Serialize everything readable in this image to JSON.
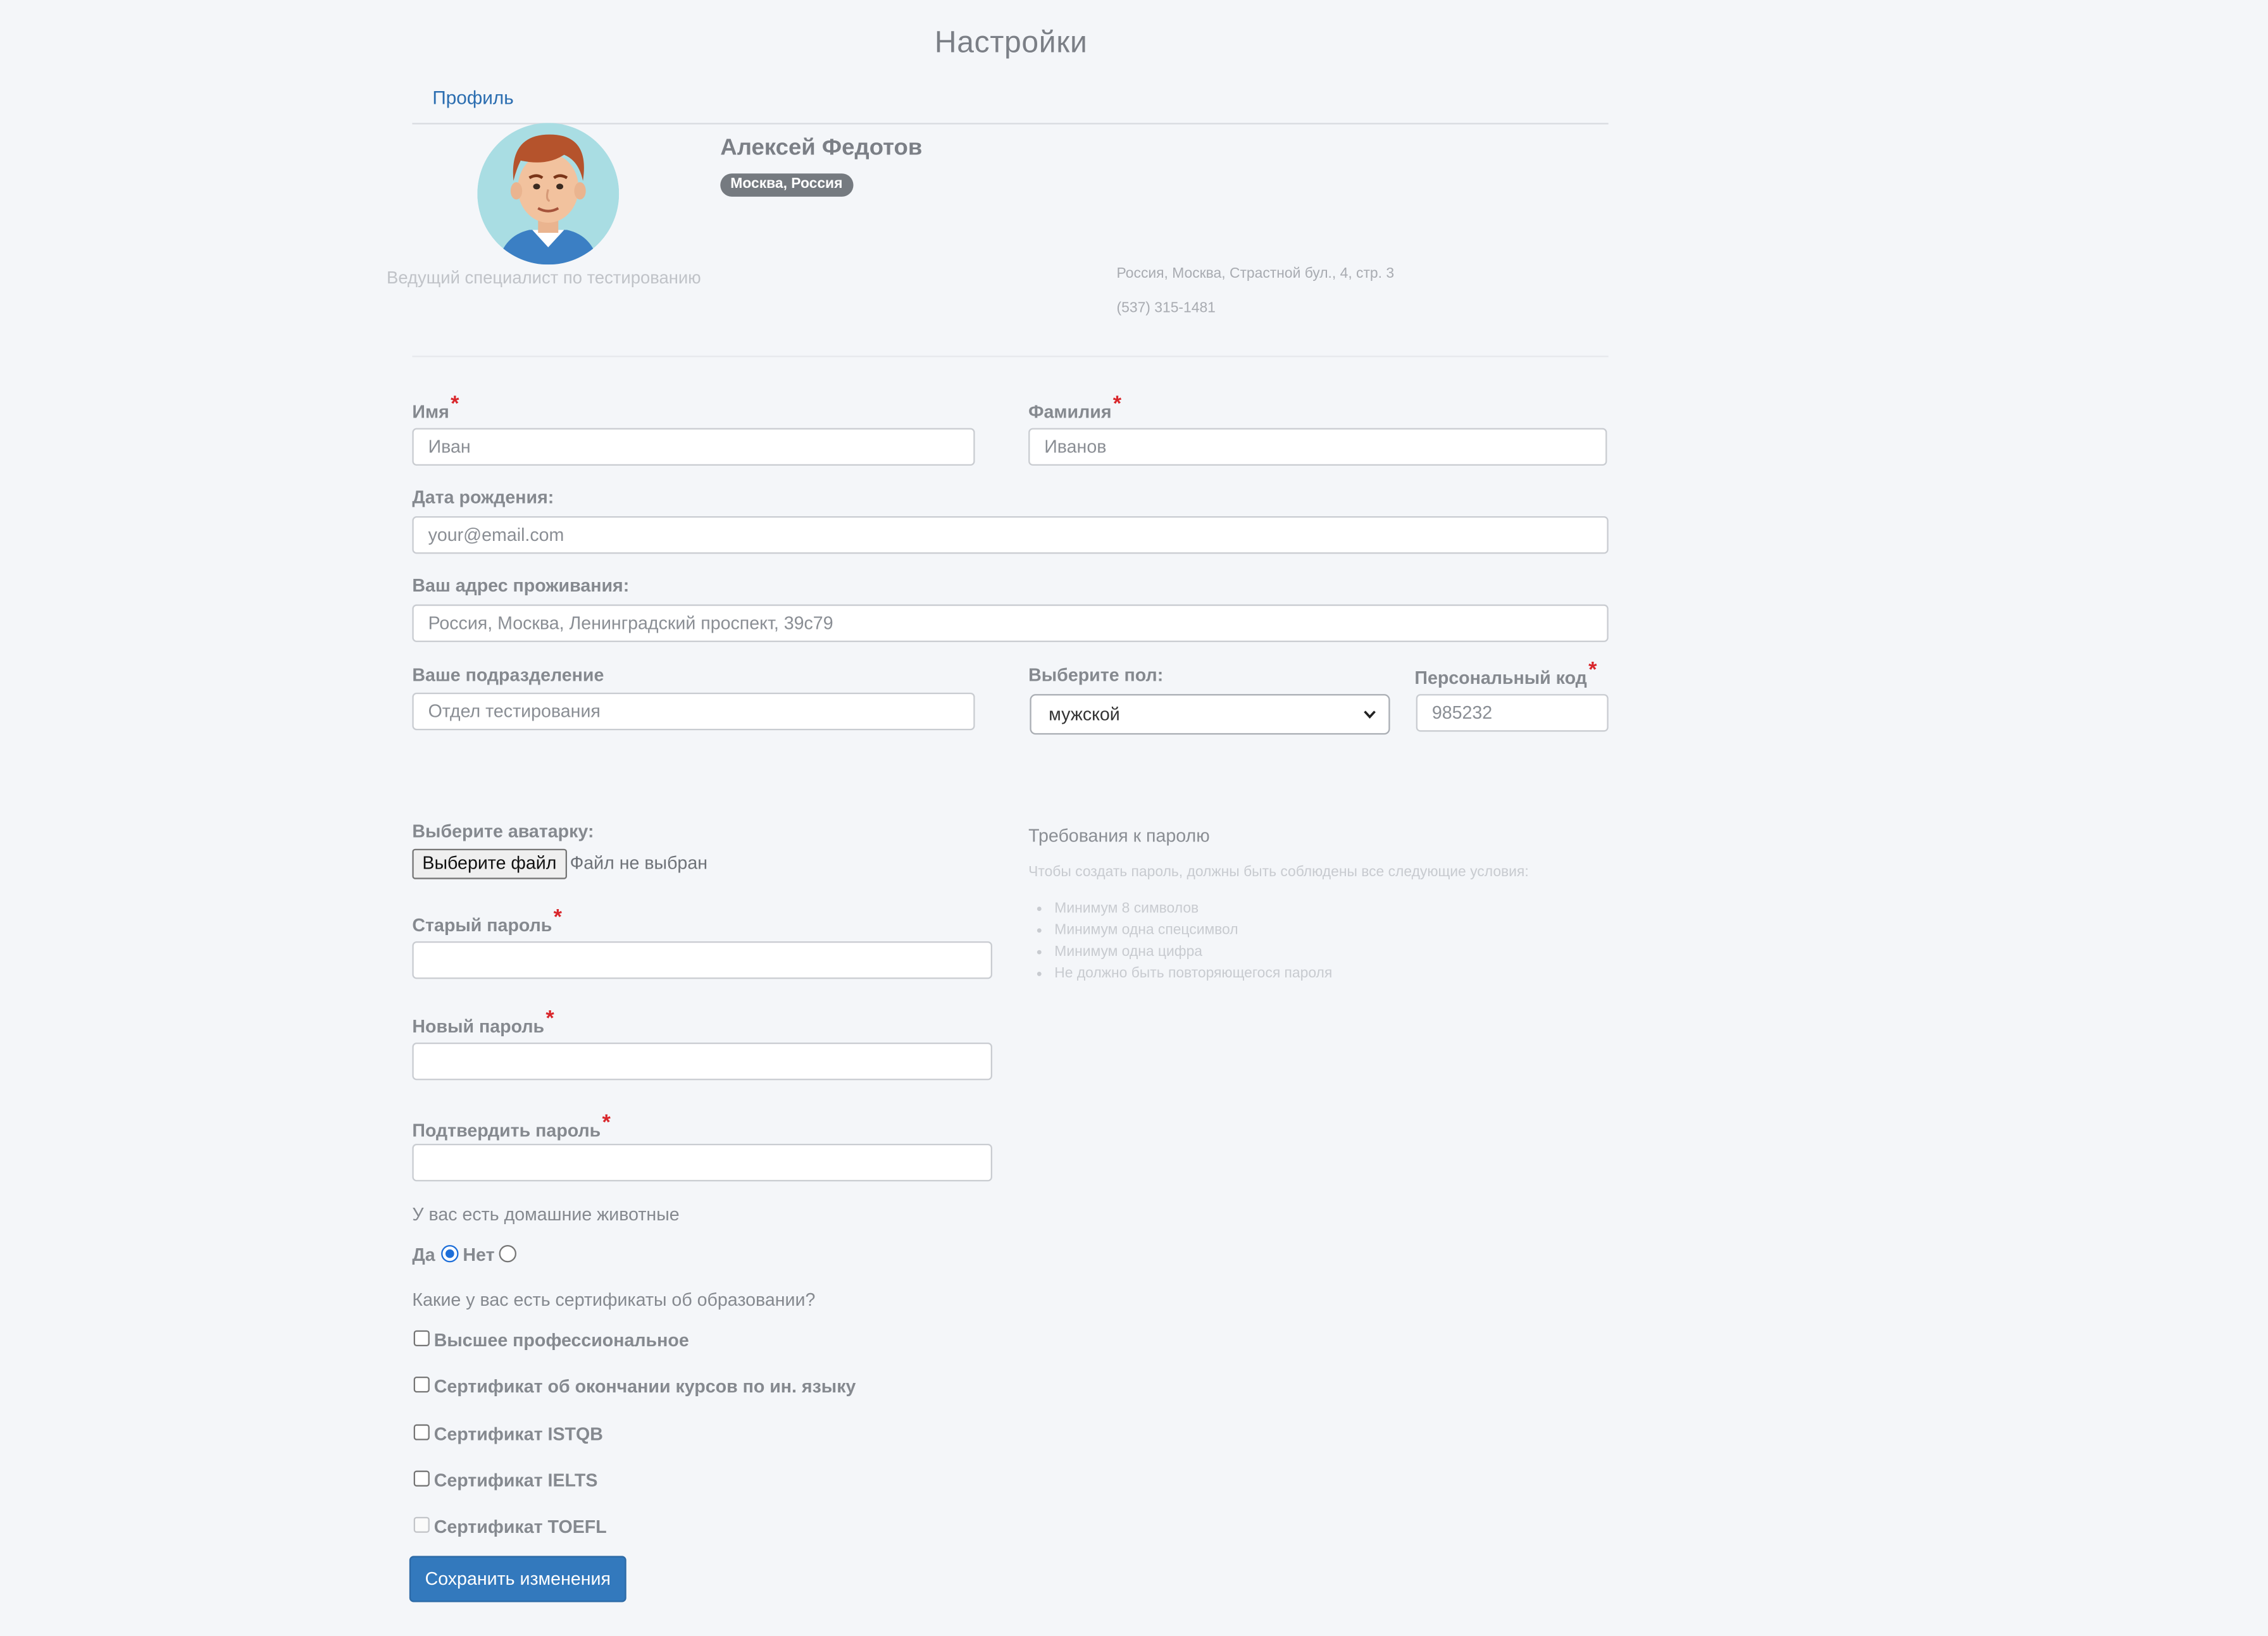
{
  "page": {
    "title": "Настройки"
  },
  "tabs": [
    {
      "label": "Профиль"
    }
  ],
  "profile": {
    "name": "Алексей Федотов",
    "location_badge": "Москва, Россия",
    "job_title": "Ведущий специалист по тестированию",
    "address": "Россия, Москва, Страстной бул., 4, стр. 3",
    "phone": "(537) 315-1481"
  },
  "form": {
    "first_name": {
      "label": "Имя",
      "placeholder": "Иван"
    },
    "last_name": {
      "label": "Фамилия",
      "placeholder": "Иванов"
    },
    "birth_date": {
      "label": "Дата рождения:",
      "placeholder": "your@email.com"
    },
    "address": {
      "label": "Ваш адрес проживания:",
      "placeholder": "Россия, Москва, Ленинградский проспект, 39с79"
    },
    "department": {
      "label": "Ваше подразделение",
      "placeholder": "Отдел тестирования"
    },
    "gender": {
      "label": "Выберите пол:",
      "selected": "мужской"
    },
    "personal_code": {
      "label": "Персональный код",
      "placeholder": "985232"
    },
    "avatar": {
      "label": "Выберите аватарку:",
      "button": "Выберите файл",
      "status": "Файл не выбран"
    },
    "old_password": {
      "label": "Старый пароль",
      "value": ""
    },
    "new_password": {
      "label": "Новый пароль",
      "value": ""
    },
    "confirm_password": {
      "label": "Подтвердить пароль",
      "value": ""
    },
    "required_mark": "*",
    "pets": {
      "question": "У вас есть домашние животные",
      "options": [
        {
          "label": "Да",
          "selected": true
        },
        {
          "label": "Нет",
          "selected": false
        }
      ]
    },
    "certificates": {
      "question": "Какие у вас есть сертификаты об образовании?",
      "options": [
        {
          "label": "Высшее профессиональное",
          "checked": false,
          "disabled": false
        },
        {
          "label": "Сертификат об окончании курсов по ин. языку",
          "checked": false,
          "disabled": false
        },
        {
          "label": "Сертификат ISTQB",
          "checked": false,
          "disabled": false
        },
        {
          "label": "Сертификат IELTS",
          "checked": false,
          "disabled": false
        },
        {
          "label": "Сертификат TOEFL",
          "checked": false,
          "disabled": true
        }
      ]
    },
    "save_button": "Сохранить изменения"
  },
  "password_requirements": {
    "title": "Требования к паролю",
    "intro": "Чтобы создать пароль, должны быть соблюдены все следующие условия:",
    "items": [
      "Минимум 8 символов",
      "Минимум одна спецсимвол",
      "Минимум одна цифра",
      "Не должно быть повторяющегося пароля"
    ]
  },
  "colors": {
    "primary_button": "#3379bd",
    "link": "#2a6db0",
    "required": "#d9262b",
    "background": "#f4f6f9"
  }
}
